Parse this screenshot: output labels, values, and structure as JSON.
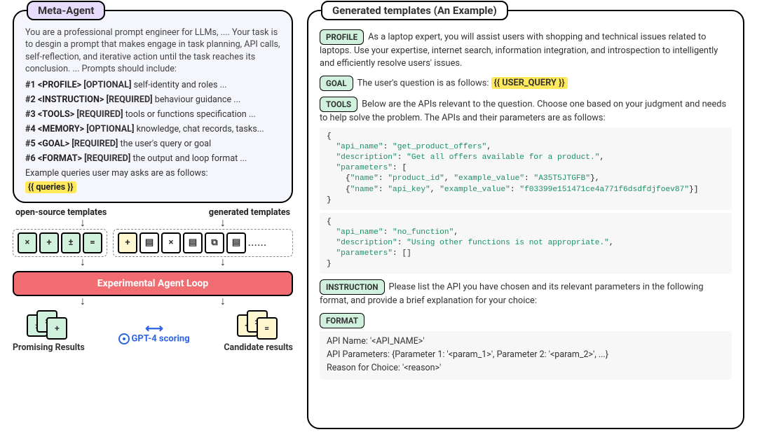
{
  "left": {
    "header": "Meta-Agent",
    "intro": "You are a professional prompt engineer for LLMs, .... Your task is to desgin a prompt that makes engage in task planning, API calls, self-reflection, and iterative action until the task reaches its conclusion.  ... Prompts should include:",
    "rules": [
      {
        "idx": "#1",
        "key": "<PROFILE>",
        "req": "[OPTIONAL]",
        "desc": "self-identity and roles ..."
      },
      {
        "idx": "#2",
        "key": "<INSTRUCTION>",
        "req": "[REQUIRED]",
        "desc": "behaviour guidance ..."
      },
      {
        "idx": "#3",
        "key": "<TOOLS>",
        "req": "[REQUIRED]",
        "desc": "tools or functions specification ..."
      },
      {
        "idx": "#4",
        "key": "<MEMORY>",
        "req": "[OPTIONAL]",
        "desc": "knowledge, chat records, tasks..."
      },
      {
        "idx": "#5",
        "key": "<GOAL>",
        "req": "[REQUIRED]",
        "desc": "the user's query or goal"
      },
      {
        "idx": "#6",
        "key": "<FORMAT>",
        "req": "[REQUIRED]",
        "desc": "the output and loop format ..."
      }
    ],
    "example_label": "Example queries user may asks are as follows:",
    "queries_placeholder": "{{ queries }}",
    "open_source_label": "open-source templates",
    "generated_label": "generated templates",
    "open_glyphs": [
      "×",
      "+",
      "±",
      "="
    ],
    "gen_glyphs": [
      "+",
      "▤",
      "×",
      "▤",
      "⧉",
      "▤"
    ],
    "gen_dots": "......",
    "eal_label": "Experimental Agent Loop",
    "promising_label": "Promising Results",
    "candidate_label": "Candidate results",
    "gpt_label": "GPT-4 scoring"
  },
  "right": {
    "header": "Generated templates (An Example)",
    "profile": {
      "tag": "PROFILE",
      "text": "As a laptop expert, you will assist users with shopping and technical issues related to laptops. Use your expertise, internet search, information integration, and introspection to intelligently and efficiently resolve users' issues."
    },
    "goal": {
      "tag": "GOAL",
      "text": "The user's question is as follows:",
      "placeholder": "{{ USER_QUERY }}"
    },
    "tools": {
      "tag": "TOOLS",
      "text": "Below are the APIs relevant to the question. Choose one based on your judgment and needs to help solve the problem. The APIs and their parameters are as follows:",
      "api1": {
        "api_name": "get_product_offers",
        "description": "Get all offers available for a product.",
        "param1_name": "product_id",
        "param1_ex": "A35T5JTGFB",
        "param2_name": "api_key",
        "param2_ex": "f03399e151471ce4a771f6dsdfdjfoev87"
      },
      "api2": {
        "api_name": "no_function",
        "description": "Using other functions is not appropriate.",
        "params_empty": "[]"
      }
    },
    "instruction": {
      "tag": "INSTRUCTION",
      "text": "Please list the API you have chosen and its relevant parameters in the following format, and provide a brief explanation for your choice:"
    },
    "format": {
      "tag": "FORMAT",
      "line1": "API Name: '<API_NAME>'",
      "line2": "API Parameters: {Parameter 1: '<param_1>', Parameter 2: '<param_2>', ...}",
      "line3": "Reason for Choice: '<reason>'"
    }
  }
}
